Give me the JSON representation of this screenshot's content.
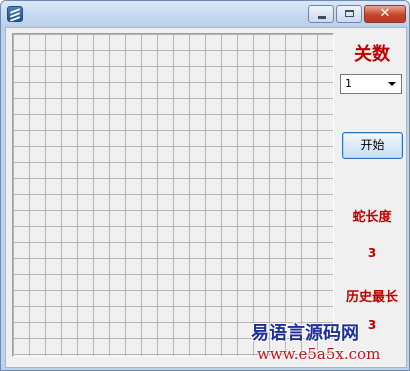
{
  "window": {
    "title": "",
    "buttons": {
      "minimize": "minimize",
      "maximize": "maximize",
      "close": "✕"
    }
  },
  "colors": {
    "label_red": "#c00000",
    "watermark_cn": "#1e2f9a",
    "watermark_url": "#c0141a"
  },
  "game": {
    "board": {
      "columns": 20,
      "rows": 20
    },
    "level_label": "关数",
    "level_select": {
      "value": "1"
    },
    "start_button": "开始",
    "snake_length_label": "蛇长度",
    "snake_length_value": "3",
    "history_max_label": "历史最长",
    "history_max_value": "3"
  },
  "watermark": {
    "site_name": "易语言源码网",
    "url": "www.e5a5x.com"
  }
}
